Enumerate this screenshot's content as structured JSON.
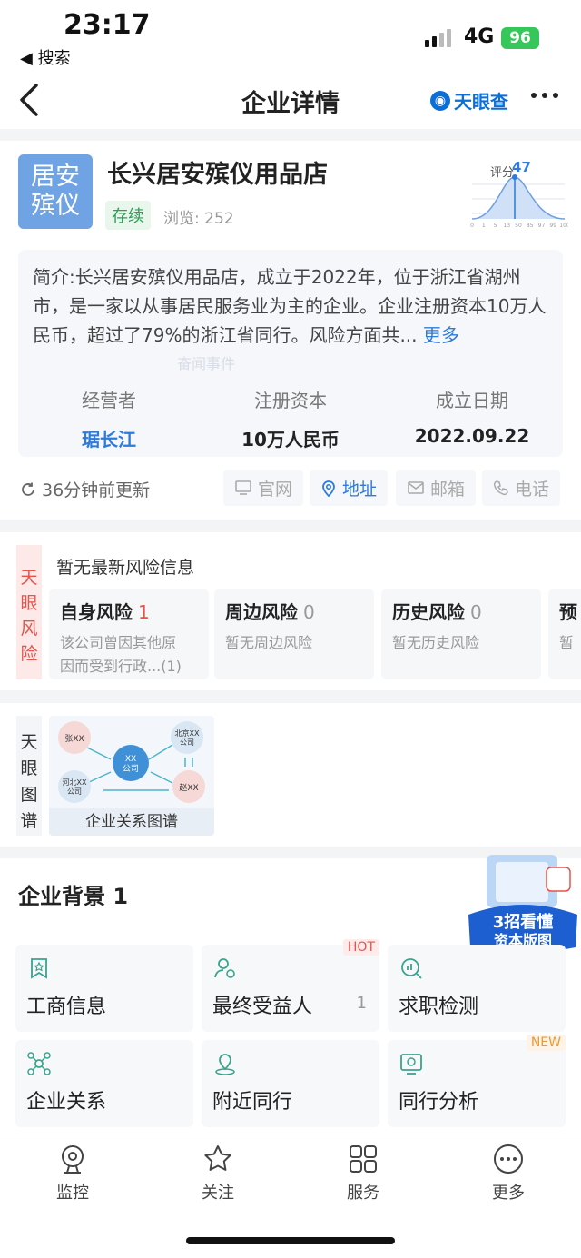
{
  "status_bar": {
    "time": "23:17",
    "back_app": "◀ 搜索",
    "network": "4G",
    "battery": "96"
  },
  "nav": {
    "title": "企业详情",
    "brand": "天眼查"
  },
  "company": {
    "logo_text": [
      "居安",
      "殡仪"
    ],
    "name": "长兴居安殡仪用品店",
    "status": "存续",
    "views_label": "浏览: 252",
    "score_label": "评分",
    "score_value": "47",
    "score_axis": [
      "0",
      "1",
      "5",
      "13",
      "50",
      "85",
      "97",
      "99",
      "100"
    ]
  },
  "intro": {
    "text": "简介:长兴居安殡仪用品店，成立于2022年，位于浙江省湖州市，是一家以从事居民服务业为主的企业。企业注册资本10万人民币，超过了79%的浙江省同行。风险方面共...",
    "more": "更多",
    "watermark": "奋闻事件",
    "stats": [
      {
        "key": "经营者",
        "value": "琚长江"
      },
      {
        "key": "注册资本",
        "value": "10万人民币"
      },
      {
        "key": "成立日期",
        "value": "2022.09.22"
      }
    ]
  },
  "update_row": {
    "updated": "36分钟前更新",
    "chips": [
      "官网",
      "地址",
      "邮箱",
      "电话"
    ]
  },
  "risk": {
    "side_label": [
      "天",
      "眼",
      "风",
      "险"
    ],
    "headline": "暂无最新风险信息",
    "cards": [
      {
        "title": "自身风险",
        "count": "1",
        "desc1": "该公司曾因其他原",
        "desc2": "因而受到行政...(1)"
      },
      {
        "title": "周边风险",
        "count": "0",
        "desc1": "暂无周边风险",
        "desc2": ""
      },
      {
        "title": "历史风险",
        "count": "0",
        "desc1": "暂无历史风险",
        "desc2": ""
      },
      {
        "title": "预",
        "count": "",
        "desc1": "暂",
        "desc2": ""
      }
    ]
  },
  "graph": {
    "side_label": [
      "天",
      "眼",
      "图",
      "谱"
    ],
    "caption": "企业关系图谱",
    "nodes": [
      "张XX",
      "XX",
      "公司",
      "北京XX",
      "公司",
      "河北XX",
      "公司",
      "赵XX"
    ]
  },
  "background": {
    "title": "企业背景 1",
    "promo_lines": [
      "3招看懂",
      "资本版图"
    ],
    "services": [
      {
        "label": "工商信息",
        "count": "",
        "tag": ""
      },
      {
        "label": "最终受益人",
        "count": "1",
        "tag": "HOT"
      },
      {
        "label": "求职检测",
        "count": "",
        "tag": ""
      },
      {
        "label": "企业关系",
        "count": "",
        "tag": ""
      },
      {
        "label": "附近同行",
        "count": "",
        "tag": ""
      },
      {
        "label": "同行分析",
        "count": "",
        "tag": "NEW"
      }
    ]
  },
  "tabbar": {
    "tabs": [
      "监控",
      "关注",
      "服务",
      "更多"
    ]
  },
  "colors": {
    "brand_blue": "#2d7bdc",
    "risk_red": "#e5534b",
    "status_green": "#2e9d56",
    "battery_green": "#35c759"
  }
}
